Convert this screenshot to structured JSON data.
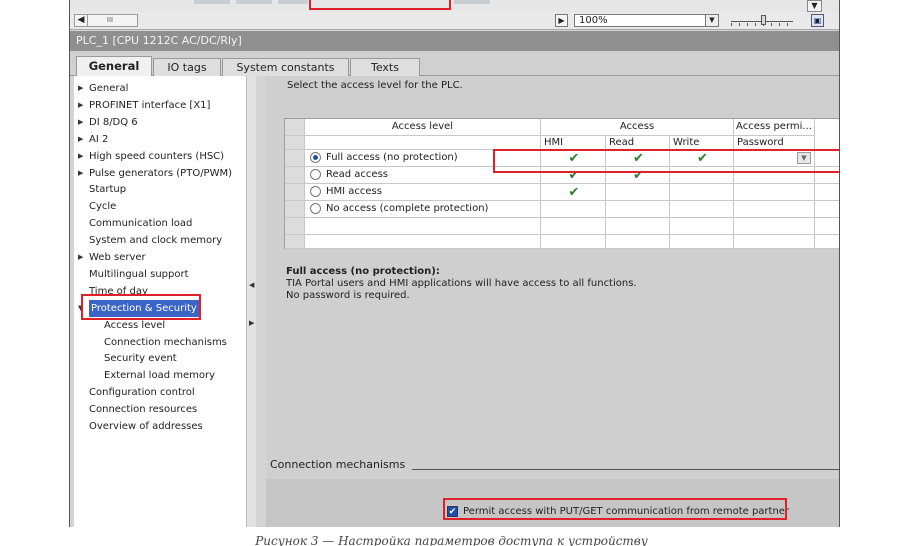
{
  "toolbar": {
    "zoom_value": "100%",
    "hscroll_thumb": "III"
  },
  "device_title": "PLC_1 [CPU 1212C AC/DC/Rly]",
  "tabs": [
    {
      "label": "General"
    },
    {
      "label": "IO tags"
    },
    {
      "label": "System constants"
    },
    {
      "label": "Texts"
    }
  ],
  "nav": [
    {
      "label": "General",
      "expandable": true
    },
    {
      "label": "PROFINET interface [X1]",
      "expandable": true
    },
    {
      "label": "DI 8/DQ 6",
      "expandable": true
    },
    {
      "label": "AI 2",
      "expandable": true
    },
    {
      "label": "High speed counters (HSC)",
      "expandable": true
    },
    {
      "label": "Pulse generators (PTO/PWM)",
      "expandable": true
    },
    {
      "label": "Startup"
    },
    {
      "label": "Cycle"
    },
    {
      "label": "Communication load"
    },
    {
      "label": "System and clock memory"
    },
    {
      "label": "Web server",
      "expandable": true
    },
    {
      "label": "Multilingual support"
    },
    {
      "label": "Time of day"
    },
    {
      "label": "Protection & Security",
      "expandable": true,
      "selected": true
    },
    {
      "label": "Access level",
      "indent": true
    },
    {
      "label": "Connection mechanisms",
      "indent": true
    },
    {
      "label": "Security event",
      "indent": true
    },
    {
      "label": "External load memory",
      "indent": true
    },
    {
      "label": "Configuration control"
    },
    {
      "label": "Connection resources"
    },
    {
      "label": "Overview of addresses"
    }
  ],
  "access": {
    "instruction": "Select the access level for the PLC.",
    "headers": {
      "level": "Access level",
      "access": "Access",
      "perm": "Access permi...",
      "hmi": "HMI",
      "read": "Read",
      "write": "Write",
      "password": "Password"
    },
    "rows": [
      {
        "label": "Full access (no protection)",
        "selected": true,
        "hmi": true,
        "read": true,
        "write": true
      },
      {
        "label": "Read access",
        "selected": false,
        "hmi": true,
        "read": true,
        "write": false
      },
      {
        "label": "HMI access",
        "selected": false,
        "hmi": true,
        "read": false,
        "write": false
      },
      {
        "label": "No access (complete protection)",
        "selected": false,
        "hmi": false,
        "read": false,
        "write": false
      }
    ],
    "check_glyph": "✔"
  },
  "description": {
    "title": "Full access (no protection):",
    "line1": "TIA Portal users and HMI applications will have access to all functions.",
    "line2": "No password is required."
  },
  "connection": {
    "title": "Connection mechanisms",
    "permit_label": "Permit access with PUT/GET communication from remote partner",
    "permit_checked": true
  },
  "caption": "Рисунок 3 — Настройка параметров доступа к устройству",
  "colors": {
    "highlight": "#e0202a",
    "selection": "#3a64c6",
    "check": "#2c7d2c"
  }
}
